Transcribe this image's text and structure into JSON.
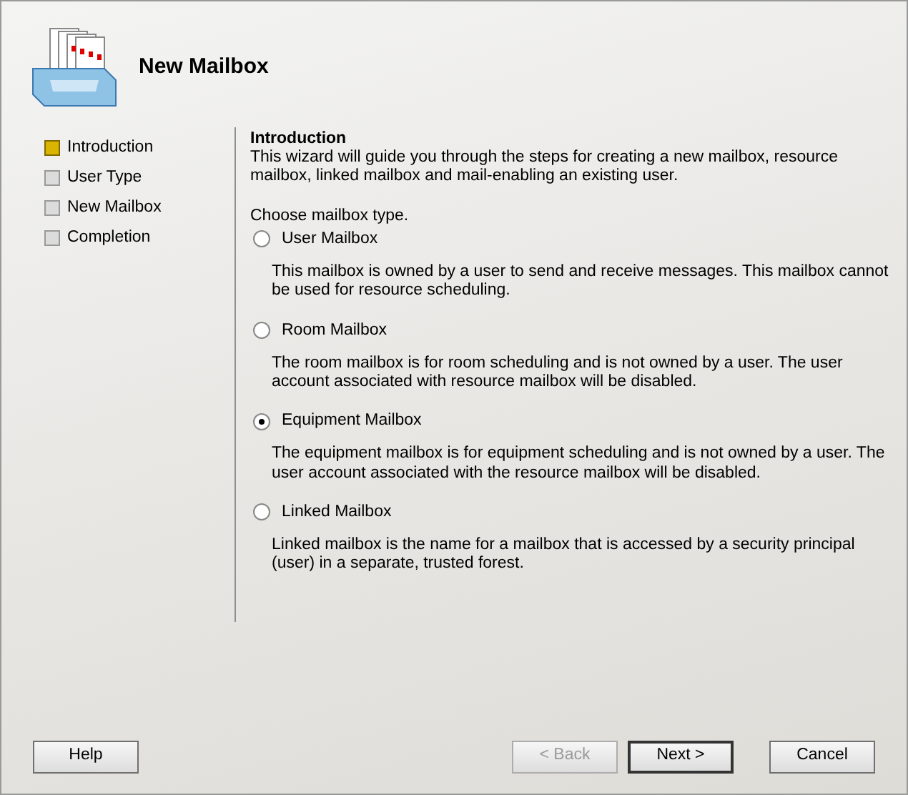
{
  "header": {
    "title": "New Mailbox"
  },
  "steps": [
    {
      "label": "Introduction",
      "selected": true
    },
    {
      "label": "User Type",
      "selected": false
    },
    {
      "label": "New Mailbox",
      "selected": false
    },
    {
      "label": "Completion",
      "selected": false
    }
  ],
  "content": {
    "heading": "Introduction",
    "intro": "This wizard will guide you through the steps for creating a new mailbox, resource mailbox, linked mailbox and mail-enabling an existing user.",
    "prompt": "Choose mailbox type.",
    "options": [
      {
        "label": "User Mailbox",
        "selected": false,
        "description": "This mailbox is owned by a user to send and receive messages. This mailbox cannot be used for resource scheduling."
      },
      {
        "label": "Room Mailbox",
        "selected": false,
        "description": "The room mailbox is for room scheduling and is not owned by a user. The user account associated with resource mailbox will be disabled."
      },
      {
        "label": "Equipment Mailbox",
        "selected": true,
        "description": "The equipment mailbox is for equipment scheduling and is not owned by a user. The user account associated with the resource mailbox will be disabled."
      },
      {
        "label": "Linked Mailbox",
        "selected": false,
        "description": "Linked mailbox is the name for a mailbox that is accessed by a security principal (user) in a separate, trusted forest."
      }
    ]
  },
  "buttons": [
    {
      "label": "Help",
      "kind": "left",
      "disabled": false,
      "default": false
    },
    {
      "label": "< Back",
      "kind": "right",
      "disabled": true,
      "default": false
    },
    {
      "label": "Next >",
      "kind": "right",
      "disabled": false,
      "default": true
    },
    {
      "label": "Cancel",
      "kind": "right",
      "disabled": false,
      "default": false
    }
  ]
}
